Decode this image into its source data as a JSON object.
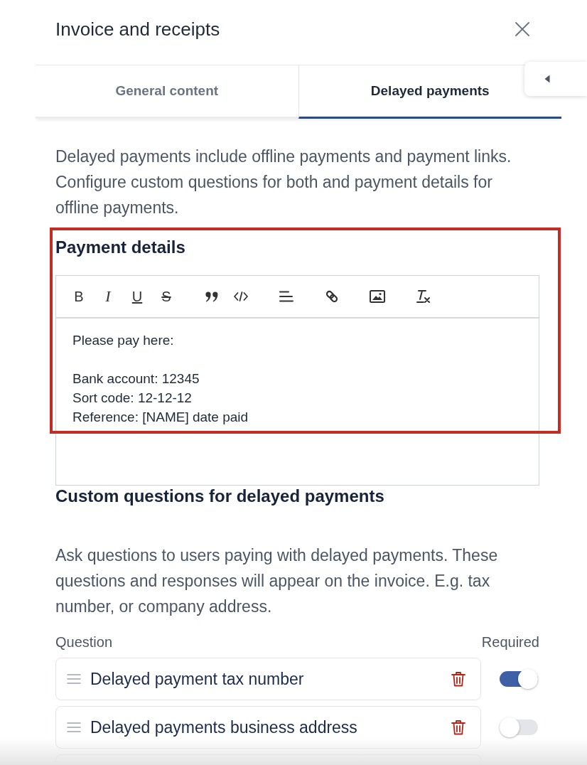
{
  "header": {
    "title": "Invoice and receipts"
  },
  "tabs": [
    {
      "label": "General content",
      "selected": false
    },
    {
      "label": "Delayed payments",
      "selected": true
    }
  ],
  "description": "Delayed payments include offline payments and payment links. Configure custom questions for both and payment details for offline payments.",
  "payment_details": {
    "heading": "Payment details",
    "highlighted": true,
    "toolbar": [
      [
        {
          "kind": "bold",
          "glyph": "B"
        },
        {
          "kind": "italic",
          "glyph": "I"
        },
        {
          "kind": "underline",
          "glyph": "U"
        },
        {
          "kind": "strikethrough",
          "glyph": "S"
        }
      ],
      [
        {
          "kind": "quote"
        },
        {
          "kind": "code"
        }
      ],
      [
        {
          "kind": "align"
        }
      ],
      [
        {
          "kind": "link"
        }
      ],
      [
        {
          "kind": "image"
        }
      ],
      [
        {
          "kind": "clear_format"
        }
      ]
    ],
    "content": [
      [
        "Please pay here:"
      ],
      [
        "Bank account: 12345",
        "Sort code: 12-12-12",
        "Reference: [NAME] date paid"
      ]
    ]
  },
  "custom_questions": {
    "heading": "Custom questions for delayed payments",
    "description": "Ask questions to users paying with delayed payments. These questions and responses will appear on the invoice. E.g. tax number, or company address.",
    "columns": [
      "Question",
      "Required"
    ],
    "rows": [
      {
        "question": "Delayed payment tax number",
        "required": true
      },
      {
        "question": "Delayed payments business address",
        "required": false
      }
    ]
  }
}
